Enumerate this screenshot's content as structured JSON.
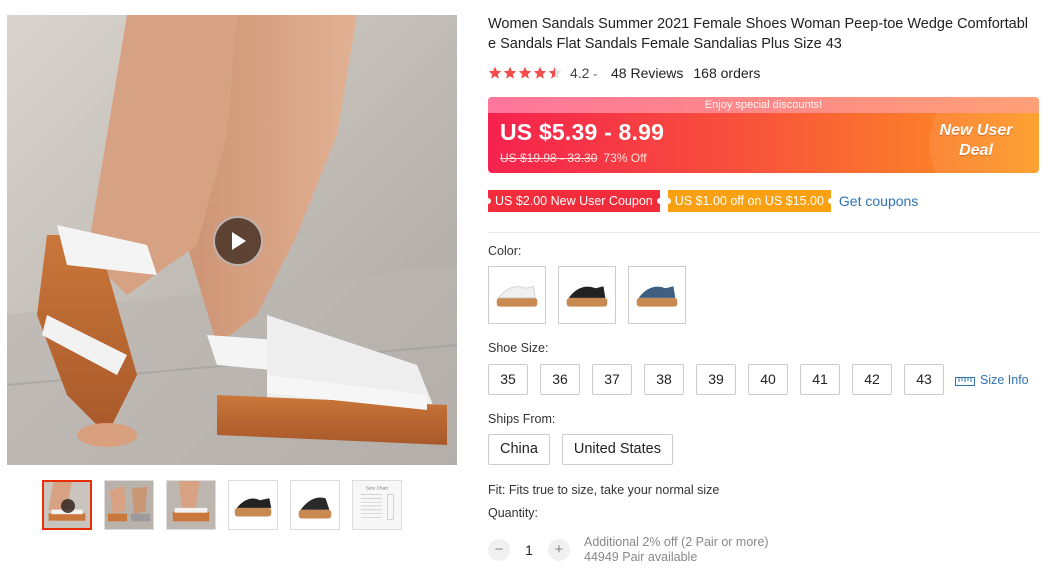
{
  "product": {
    "title": "Women Sandals Summer 2021 Female Shoes Woman Peep-toe Wedge Comfortable Sandals Flat Sandals Female Sandalias Plus Size 43",
    "rating": {
      "stars": 4.5,
      "score": "4.2",
      "reviews": "48 Reviews",
      "orders": "168 orders"
    }
  },
  "gallery": {
    "main_image": "photo of legs wearing white sandals with cork wedge",
    "thumbnails": [
      "thumb-1-video",
      "thumb-2",
      "thumb-3",
      "thumb-4",
      "thumb-5",
      "thumb-6-size-chart"
    ],
    "size_chart_label": "Size Chart"
  },
  "banner": {
    "top_text": "Enjoy special discounts!",
    "price": "US $5.39 - 8.99",
    "original_price": "US $19.98 - 33.30",
    "discount": "73% Off",
    "deal_line1": "New User",
    "deal_line2": "Deal"
  },
  "coupons": {
    "coupon1": "US $2.00 New User Coupon",
    "coupon2": "US $1.00 off on US $15.00",
    "get_coupons": "Get coupons"
  },
  "options": {
    "color_label": "Color:",
    "colors": [
      "white",
      "black",
      "blue"
    ],
    "size_label": "Shoe Size:",
    "sizes": [
      "35",
      "36",
      "37",
      "38",
      "39",
      "40",
      "41",
      "42",
      "43"
    ],
    "size_info": "Size Info",
    "ships_label": "Ships From:",
    "ships": [
      "China",
      "United States"
    ]
  },
  "fit": "Fit: Fits true to size, take your normal size",
  "quantity": {
    "label": "Quantity:",
    "value": "1",
    "minus": "−",
    "plus": "+",
    "note1": "Additional 2% off (2 Pair or more)",
    "note2": "44949 Pair available"
  },
  "colors_theme": {
    "accent": "#e62e04",
    "link": "#2e74b5",
    "star": "#f24c4c"
  }
}
